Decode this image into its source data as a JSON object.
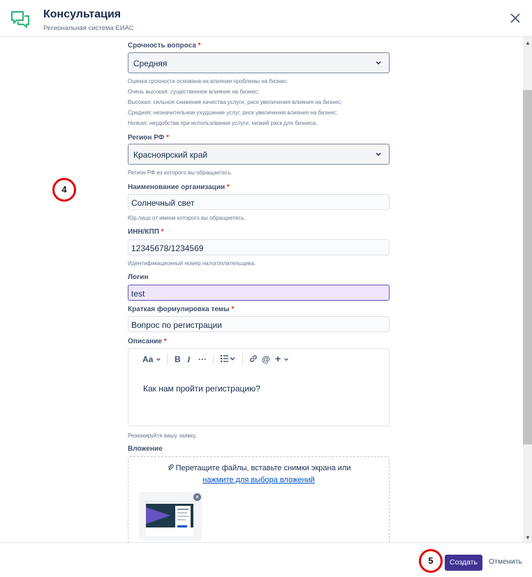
{
  "header": {
    "title": "Консультация",
    "subtitle": "Региональная система ЕИАС",
    "logo_icon": "chat-bubbles-icon",
    "close_icon": "close-icon"
  },
  "form": {
    "urgency": {
      "label": "Срочность вопроса",
      "required_mark": "*",
      "value": "Средняя",
      "help": [
        "Оценка срочности основана на влиянии проблемы на бизнес.",
        "Очень высокая: существенное влияние на бизнес;",
        "Высокая: сильное снижение качества услуги, риск увеличения влияния на бизнес;",
        "Средняя: незначительное ухудшение услуг, риск увеличения влияния на бизнес;",
        "Низкая: неудобства при использовании услуги, низкий риск для бизнеса."
      ]
    },
    "region": {
      "label": "Регион РФ",
      "required_mark": "*",
      "value": "Красноярский край",
      "help": "Регион РФ из которого вы обращаетесь."
    },
    "organization": {
      "label": "Наименование организации",
      "required_mark": "*",
      "value": "Солнечный свет",
      "help": "Юр.лицо от имени которого вы обращаетесь."
    },
    "inn": {
      "label": "ИНН/КПП",
      "required_mark": "*",
      "value": "12345678/1234569",
      "help": "Идентификационный номер налогоплательщика."
    },
    "login": {
      "label": "Логин",
      "value": "test"
    },
    "topic": {
      "label": "Краткая формулировка темы",
      "required_mark": "*",
      "value": "Вопрос по регистрации"
    },
    "description": {
      "label": "Описание",
      "required_mark": "*",
      "toolbar": {
        "text_style": "Aa",
        "bold": "B",
        "italic": "I",
        "more": "···",
        "mention": "@",
        "insert": "+"
      },
      "value": "Как нам пройти регистрацию?",
      "help": "Резюмируйте вашу заявку."
    },
    "attachment": {
      "label": "Вложение",
      "drop_text": "Перетащите файлы, вставьте снимки экрана или",
      "drop_link": "нажмите для выбора вложений",
      "remove_mark": "×"
    }
  },
  "markers": {
    "m4": "4",
    "m5": "5"
  },
  "footer": {
    "create_label": "Создать",
    "cancel_label": "Отменить"
  },
  "colors": {
    "accent": "#403294",
    "logo_green": "#36b37e",
    "required": "#de350b",
    "marker_red": "#e00000",
    "link": "#0052cc"
  }
}
